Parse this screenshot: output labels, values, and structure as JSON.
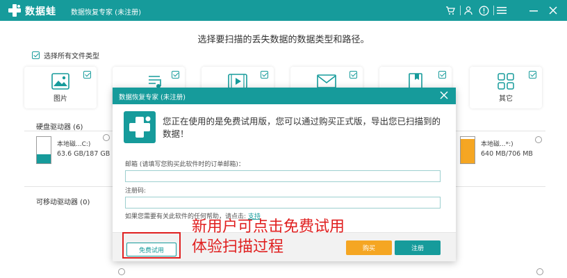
{
  "app": {
    "brand": "数据蛙",
    "title": "数据恢复专家 (未注册)",
    "accent_color": "#169b9b"
  },
  "titlebar_icons": [
    "cart-icon",
    "user-icon",
    "info-icon",
    "menu-icon",
    "minimize-icon",
    "close-icon"
  ],
  "main": {
    "prompt": "选择要扫描的丢失数据的数据类型和路径。",
    "select_all_label": "选择所有文件类型",
    "file_types": [
      {
        "label": "图片",
        "icon": "image-icon",
        "checked": true
      },
      {
        "label": "",
        "icon": "audio-icon",
        "checked": true
      },
      {
        "label": "",
        "icon": "video-icon",
        "checked": true
      },
      {
        "label": "",
        "icon": "email-icon",
        "checked": true
      },
      {
        "label": "",
        "icon": "document-icon",
        "checked": true
      },
      {
        "label": "其它",
        "icon": "other-icon",
        "checked": true
      }
    ],
    "hard_drives_label": "硬盘驱动器 (6)",
    "drives": [
      {
        "name": "本地磁...C:)",
        "size": "63.6 GB/187 GB",
        "fill_percent": 34,
        "color": "#169b9b"
      },
      {
        "name": "本地磁...*:)",
        "size": "640 MB/706 MB",
        "fill_percent": 91,
        "color": "#f5a623"
      }
    ],
    "removable_label": "可移动驱动器 (0)"
  },
  "dialog": {
    "title": "数据恢复专家 (未注册)",
    "message": "您正在使用的是免费试用版，您可以通过购买正式版，导出您已扫描到的数据！",
    "email_label": "邮箱 (请填写您购买此软件时的订单邮箱)：",
    "email_value": "",
    "code_label": "注册码:",
    "code_value": "",
    "help_text": "如果您需要有关此软件的任何帮助，请点击:",
    "help_link": "支持",
    "trial_button": "免费试用",
    "buy_button": "购买",
    "register_button": "注册"
  },
  "annotation": {
    "line1": "新用户可点击免费试用",
    "line2": "体验扫描过程",
    "color": "#e02020"
  }
}
